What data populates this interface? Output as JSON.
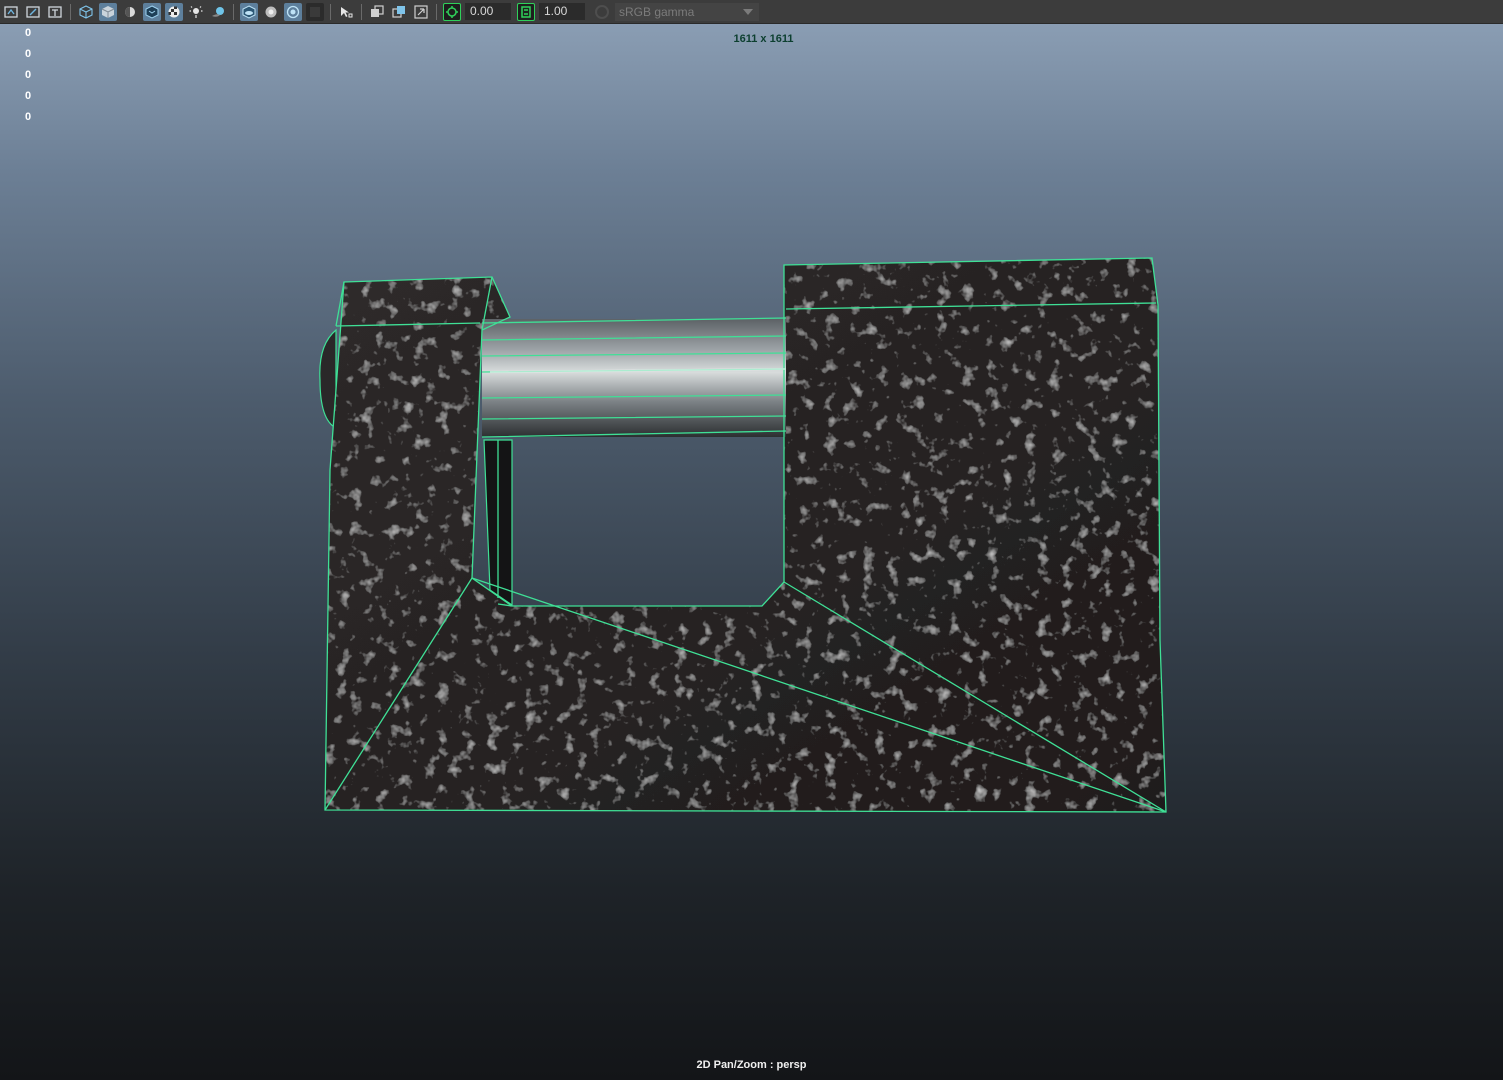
{
  "toolbar": {
    "icons_group1": [
      "camera-select-icon",
      "camera-attributes-icon",
      "grid-icon"
    ],
    "icons_group2": [
      "wireframe-icon",
      "smooth-shade-icon",
      "default-lighting-icon",
      "textured-icon",
      "checker-icon",
      "lighting-icon",
      "shadows-icon"
    ],
    "icons_group3": [
      "xray-icon",
      "xray-joints-icon",
      "xray-active-icon",
      "backface-icon"
    ],
    "icons_group4": [
      "isolate-select-icon"
    ],
    "icons_group5": [
      "frame-all-icon",
      "frame-selected-icon",
      "film-gate-icon"
    ],
    "exposure_value": "0.00",
    "gamma_value": "1.00",
    "color_space": "sRGB gamma",
    "accent_color": "#2fd05a",
    "active_color": "#5d7f9c"
  },
  "viewport": {
    "hud_counts": [
      "0",
      "0",
      "0",
      "0",
      "0"
    ],
    "resolution": "1611 x 1611",
    "camera_label": "2D Pan/Zoom : persp",
    "wire_color": "#3fe096",
    "model": "padlock"
  }
}
